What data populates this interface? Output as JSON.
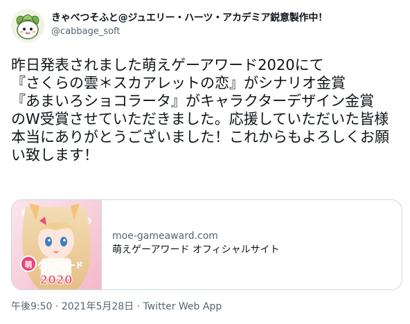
{
  "user": {
    "display_name": "きゃべつそふと@ジュエリー・ハーツ・アカデミア鋭意製作中！",
    "handle": "@cabbage_soft"
  },
  "tweet": {
    "text": "昨日発表されました萌えゲーアワード2020にて\n『さくらの雲＊スカアレットの恋』がシナリオ金賞\n『あまいろショコラータ』がキャラクターデザイン金賞\nのW受賞させていただきました。応援していただいた皆様本当にありがとうございました！これからもよろしくお願い致します！"
  },
  "card": {
    "domain": "moe-gameaward.com",
    "title": "萌えゲーアワード オフィシャルサイト",
    "thumbnail_logo_text": "萌えゲーアワード 2020"
  },
  "meta": {
    "time": "午後9:50",
    "separator1": " · ",
    "date": "2021年5月28日",
    "separator2": " · ",
    "source": "Twitter Web App"
  },
  "colors": {
    "text_primary": "#0f1419",
    "text_secondary": "#536471",
    "border": "#cfd9de"
  }
}
